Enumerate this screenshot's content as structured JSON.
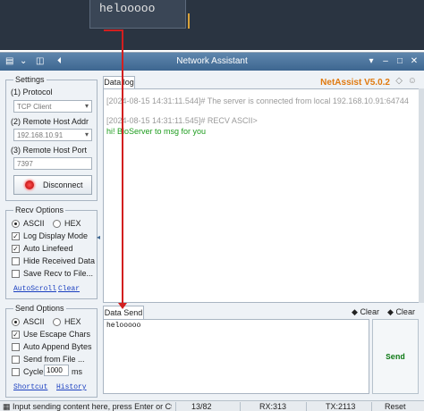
{
  "top": {
    "editor_text": "helooooo"
  },
  "window": {
    "title": "Network Assistant"
  },
  "settings": {
    "title": "Settings",
    "protocol_label": "(1) Protocol",
    "protocol_value": "TCP Client",
    "remote_addr_label": "(2) Remote Host Addr",
    "remote_addr_value": "192.168.10.91",
    "remote_port_label": "(3) Remote Host Port",
    "remote_port_value": "7397",
    "disconnect_label": "Disconnect"
  },
  "recv_options": {
    "title": "Recv Options",
    "ascii_label": "ASCII",
    "hex_label": "HEX",
    "log_display_label": "Log Display Mode",
    "auto_linefeed_label": "Auto Linefeed",
    "hide_received_label": "Hide Received Data",
    "save_recv_label": "Save Recv to File...",
    "autoscroll_link": "AutoScroll",
    "clear_link": "Clear"
  },
  "send_options": {
    "title": "Send Options",
    "ascii_label": "ASCII",
    "hex_label": "HEX",
    "escape_label": "Use Escape Chars",
    "append_bytes_label": "Auto Append Bytes",
    "send_file_label": "Send from File ...",
    "cycle_label": "Cycle",
    "cycle_value": "1000",
    "cycle_unit": "ms",
    "shortcut_link": "Shortcut",
    "history_link": "History"
  },
  "log": {
    "tab_label": "Data log",
    "brand": "NetAssist V5.0.2",
    "lines": [
      {
        "text": "[2024-08-15 14:31:11.544]# The server is connected from local 192.168.10.91:64744",
        "color": "#9a9a9a"
      },
      {
        "text": "[2024-08-15 14:31:11.545]# RECV ASCII>",
        "color": "#9a9a9a"
      },
      {
        "text": "hi! BioServer to msg for you",
        "color": "#1d9c1d"
      }
    ]
  },
  "send": {
    "tab_label": "Data Send",
    "clear1": "Clear",
    "clear2": "Clear",
    "text": "helooooo",
    "send_label": "Send"
  },
  "status": {
    "hint": "Input sending content here, press Enter or Ctrl+Er",
    "count": "13/82",
    "rx": "RX:313",
    "tx": "TX:2113",
    "reset": "Reset"
  },
  "colors": {
    "title_bar": "#4a76a0",
    "brand": "#e07a10",
    "received": "#1d9c1d",
    "annotation": "#d21f1f"
  }
}
